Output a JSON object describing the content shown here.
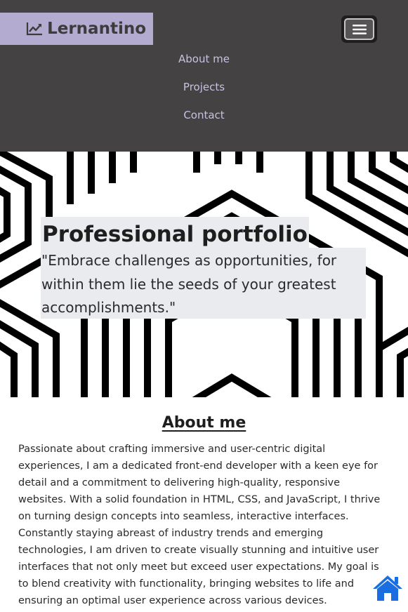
{
  "navbar": {
    "brand": "Lernantino",
    "brand_icon": "chart-line-icon",
    "toggler_icon": "hamburger-menu-icon",
    "links": [
      "About me",
      "Projects",
      "Contact"
    ]
  },
  "hero": {
    "title": "Professional portfolio",
    "quote": "\"Embrace challenges as opportunities, for within them lie the seeds of your greatest accomplishments.\""
  },
  "about": {
    "title": "About me",
    "text": "Passionate about crafting immersive and user-centric digital experiences, I am a dedicated front-end developer with a keen eye for detail and a commitment to delivering high-quality, responsive websites. With a solid foundation in HTML, CSS, and JavaScript, I thrive on turning design concepts into seamless, interactive interfaces. Constantly staying abreast of industry trends and emerging technologies, I am driven to create visually stunning and intuitive user interfaces that not only meet but exceed user expectations. My goal is to blend creativity with functionality, bringing websites to life and ensuring an optimal user experience across various devices."
  },
  "home_button": {
    "icon": "home-icon"
  },
  "colors": {
    "navbar_bg": "#444243",
    "brand_bg": "#b3abd0",
    "nav_link": "#c9c1e0",
    "home_icon": "#1a6ee0",
    "label_bg": "#e9ebee"
  }
}
